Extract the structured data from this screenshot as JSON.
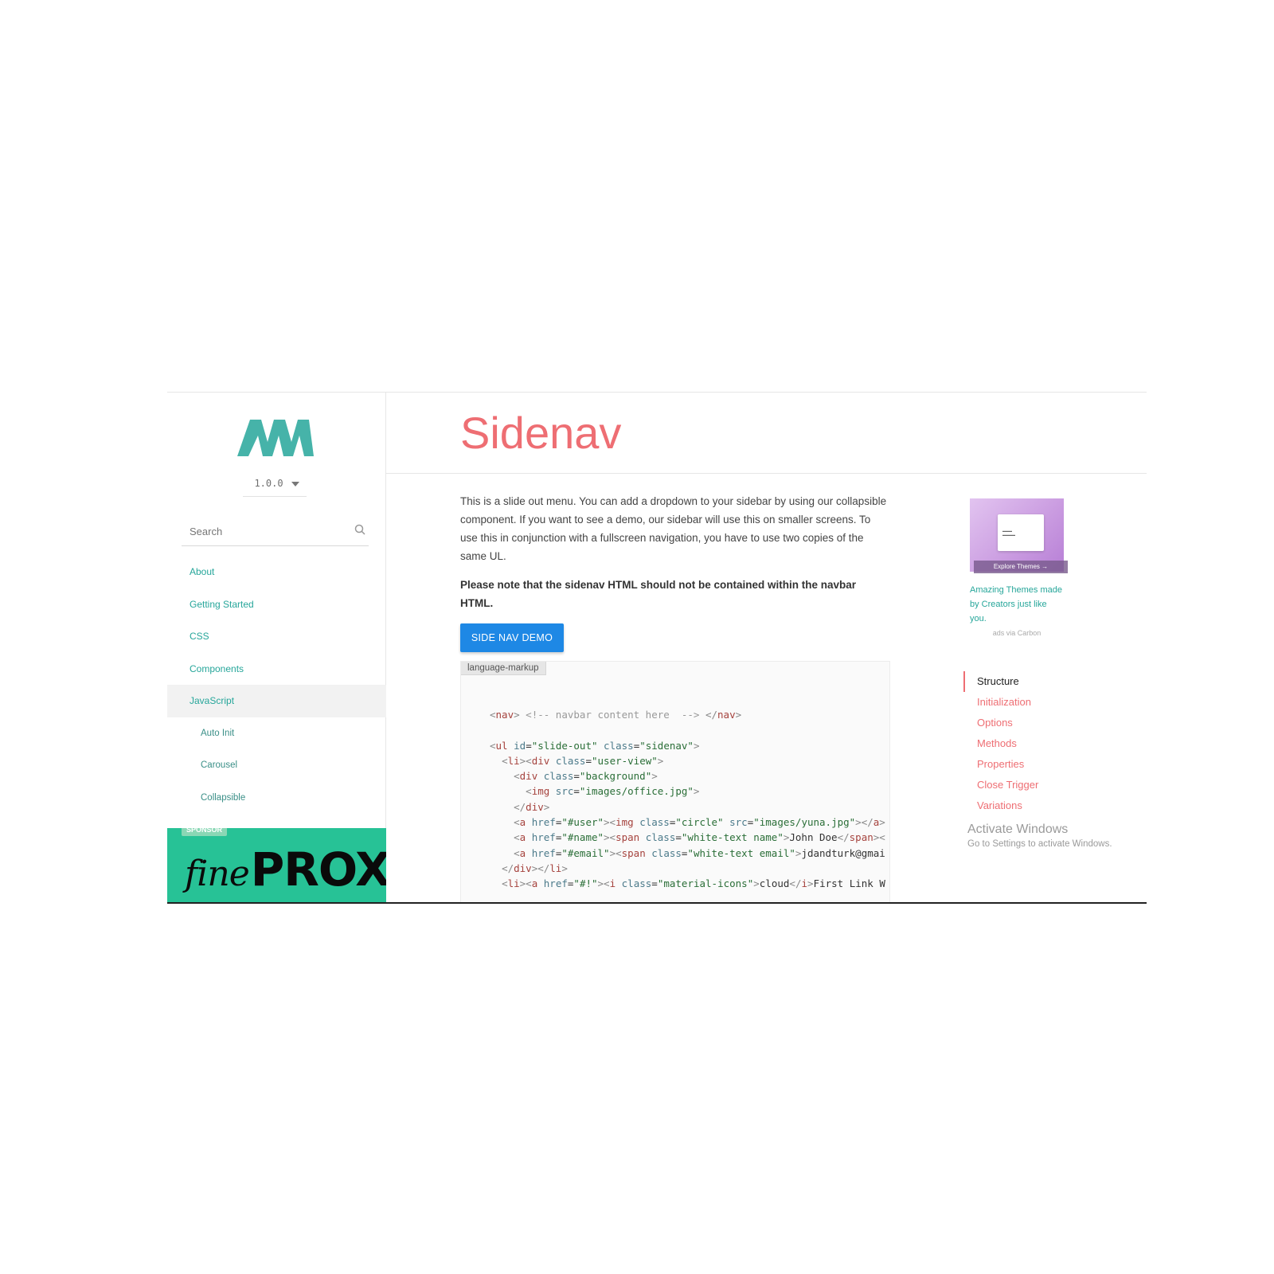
{
  "sidebar": {
    "version": "1.0.0",
    "search_placeholder": "Search",
    "items": [
      {
        "label": "About"
      },
      {
        "label": "Getting Started"
      },
      {
        "label": "CSS"
      },
      {
        "label": "Components"
      },
      {
        "label": "JavaScript"
      },
      {
        "label": "Auto Init"
      },
      {
        "label": "Carousel"
      },
      {
        "label": "Collapsible"
      }
    ],
    "sponsor_badge": "SPONSOR",
    "sponsor_logo_fine": "fine",
    "sponsor_logo_proxy": "PROXY"
  },
  "main": {
    "title": "Sidenav",
    "intro": "This is a slide out menu. You can add a dropdown to your sidebar by using our collapsible component. If you want to see a demo, our sidebar will use this on smaller screens. To use this in conjunction with a fullscreen navigation, you have to use two copies of the same UL.",
    "note": "Please note that the sidenav HTML should not be contained within the navbar HTML.",
    "demo_button": "Side Nav Demo",
    "code_lang": "language-markup"
  },
  "ad": {
    "banner_label": "Explore Themes →",
    "text": "Amazing Themes made by Creators just like you.",
    "via": "ads via Carbon"
  },
  "toc": {
    "items": [
      {
        "label": "Structure",
        "active": true
      },
      {
        "label": "Initialization"
      },
      {
        "label": "Options"
      },
      {
        "label": "Methods"
      },
      {
        "label": "Properties"
      },
      {
        "label": "Close Trigger"
      },
      {
        "label": "Variations"
      }
    ]
  },
  "windows_notice": {
    "title": "Activate Windows",
    "subtitle": "Go to Settings to activate Windows."
  },
  "colors": {
    "accent": "#ee6e73",
    "teal": "#26a69a",
    "button": "#1e88e5",
    "sponsor": "#27c296"
  }
}
